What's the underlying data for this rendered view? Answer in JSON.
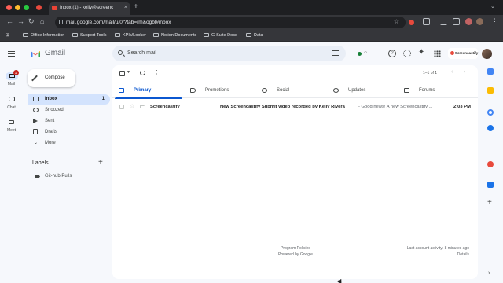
{
  "browser": {
    "tab_title": "Inbox (1) - kelly@screenc",
    "url": "mail.google.com/mail/u/0/?tab=rm&ogbl#inbox",
    "bookmarks": [
      "Office Information",
      "Support Tools",
      "KPIs/Looker",
      "Notion Documents",
      "G-Suite Docs",
      "Data"
    ]
  },
  "gmail": {
    "brand": "Gmail",
    "search_placeholder": "Search mail",
    "account_brand": "Screencastify"
  },
  "rail": [
    {
      "label": "Mail",
      "badge": "1"
    },
    {
      "label": "Chat"
    },
    {
      "label": "Meet"
    }
  ],
  "compose_label": "Compose",
  "nav": [
    {
      "label": "Inbox",
      "count": "1"
    },
    {
      "label": "Snoozed"
    },
    {
      "label": "Sent"
    },
    {
      "label": "Drafts"
    },
    {
      "label": "More"
    }
  ],
  "labels": {
    "heading": "Labels",
    "items": [
      "Git-hub Pulls"
    ]
  },
  "toolbar": {
    "pager": "1–1 of 1"
  },
  "tabs": [
    "Primary",
    "Promotions",
    "Social",
    "Updates",
    "Forums"
  ],
  "emails": [
    {
      "sender": "Screencastify",
      "subject": "New Screencastify Submit video recorded by Kelly Rivera",
      "snippet": "- Good news! A new Screencastify ...",
      "time": "2:03 PM"
    }
  ],
  "footer": {
    "program_policies": "Program Policies",
    "powered_by": "Powered by Google",
    "last_activity": "Last account activity: 8 minutes ago",
    "details": "Details"
  },
  "colors": {
    "accent": "#0b57d0",
    "selected_bg": "#d3e3fd",
    "badge": "#c5221f",
    "app_bg": "#f6f8fc"
  }
}
